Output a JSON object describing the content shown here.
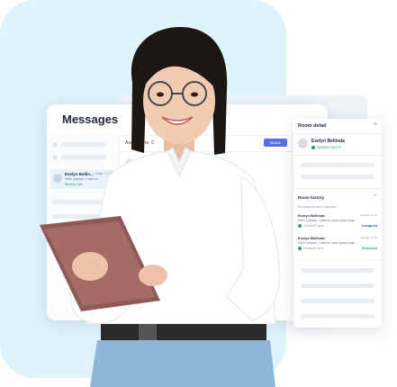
{
  "messages": {
    "title": "Messages",
    "assigned_label": "Assigned to: C",
    "assigned_button": "Mobile",
    "chat_item": {
      "name": "Evelyn Bellin...",
      "time": "Today 17:47",
      "preview": "Hello Quinlan, I want to...",
      "status": "Service Frist"
    }
  },
  "room_detail": {
    "title": "Room detail",
    "close_icon": "close-icon",
    "contact_name": "Evelyn Bellinda",
    "contact_phone": "628556798472",
    "history_title": "Room history",
    "history_showing": "Showing the last 2 histories",
    "history": [
      {
        "name": "Evelyn Bellinda",
        "time": "Monday 11:47",
        "preview": "Hello Quinlan, I want to order pizza large",
        "channel": "General Pizza",
        "badge": "Assigned",
        "badge_color": "#2d5bd7"
      },
      {
        "name": "Evelyn Bellinda",
        "time": "Sunday 10:15",
        "preview": "Hello Quinlan, I want to order pizza large",
        "channel": "General Pizza",
        "badge": "Resolved",
        "badge_color": "#22a06b"
      }
    ]
  },
  "colors": {
    "background_blob": "#dff3fb",
    "accent": "#5b6ee8",
    "success": "#22a06b",
    "assigned": "#2d5bd7"
  }
}
